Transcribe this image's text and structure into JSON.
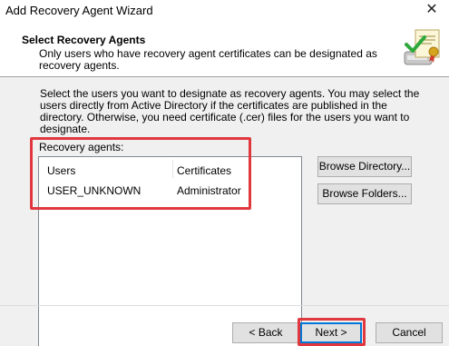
{
  "window": {
    "title": "Add Recovery Agent Wizard",
    "close_glyph": "✕"
  },
  "header": {
    "title": "Select Recovery Agents",
    "description": "Only users who have recovery agent certificates can be designated as recovery agents.",
    "icon": "wizard-certificate-icon"
  },
  "instructions": "Select the users you want to designate as recovery agents. You may select the users directly from Active Directory if the certificates are published in the directory. Otherwise, you need certificate (.cer) files for the users you want to designate.",
  "recovery_agents": {
    "label": "Recovery agents:",
    "columns": [
      "Users",
      "Certificates"
    ],
    "rows": [
      {
        "user": "USER_UNKNOWN",
        "certificate": "Administrator"
      }
    ]
  },
  "buttons": {
    "browse_directory": "Browse Directory...",
    "browse_folders": "Browse Folders...",
    "back": "< Back",
    "next": "Next >",
    "cancel": "Cancel"
  },
  "annotation_color": "#e0383e"
}
